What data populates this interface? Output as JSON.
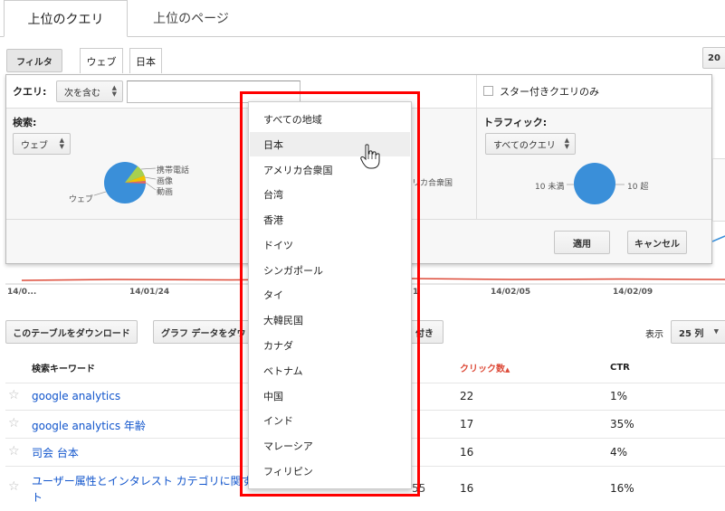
{
  "tabs": [
    {
      "label": "上位のクエリ",
      "active": true
    },
    {
      "label": "上位のページ",
      "active": false
    }
  ],
  "filter_bar": {
    "filter_label": "フィルタ",
    "chips": [
      "ウェブ",
      "日本"
    ],
    "right_stub": "20"
  },
  "query_row": {
    "label": "クエリ:",
    "condition": "次を含む",
    "input_value": "",
    "starred_only_label": "スター付きクエリのみ"
  },
  "search_section": {
    "label": "検索:",
    "select": "ウェブ",
    "pie_labels": [
      "携帯電話",
      "画像",
      "動画",
      "ウェブ"
    ],
    "location_pie_label_partial": "リカ合衆国"
  },
  "traffic_section": {
    "label": "トラフィック:",
    "select": "すべてのクエリ",
    "left_label": "10 未満",
    "right_label": "10 超"
  },
  "panel_buttons": {
    "apply": "適用",
    "cancel": "キャンセル"
  },
  "location_dropdown": {
    "highlighted_index": 1,
    "options": [
      "すべての地域",
      "日本",
      "アメリカ合衆国",
      "台湾",
      "香港",
      "ドイツ",
      "シンガポール",
      "タイ",
      "大韓民国",
      "カナダ",
      "ベトナム",
      "中国",
      "インド",
      "マレーシア",
      "フィリピン"
    ]
  },
  "chart_axis": {
    "ticks": [
      "14/0...",
      "14/01/24",
      "1",
      "14/02/05",
      "14/02/09"
    ]
  },
  "table_toolbar": {
    "download_table": "このテーブルをダウンロード",
    "download_chart_partial": "グラフ データをダウ",
    "third_button_partial": "付き",
    "show_label": "表示",
    "rows_select": "25 列"
  },
  "table": {
    "columns": {
      "keyword": "検索キーワード",
      "clicks": "クリック数",
      "ctr": "CTR"
    },
    "sort_indicator": "▲",
    "rows": [
      {
        "keyword": "google analytics",
        "clicks": "22",
        "ctr": "1%"
      },
      {
        "keyword": "google analytics 年齢",
        "clicks": "17",
        "ctr": "35%"
      },
      {
        "keyword": "司会 台本",
        "clicks": "16",
        "ctr": "4%"
      },
      {
        "keyword": "ユーザー属性とインタレスト カテゴリに関す",
        "keyword_wrap": "ト",
        "hidden_partial": "55",
        "clicks": "16",
        "ctr": "16%"
      }
    ]
  },
  "colors": {
    "link": "#1155cc",
    "sort_header": "#dd4b39",
    "pie_blue": "#3a8fd9",
    "pie_green": "#a8d04f",
    "pie_yellow": "#f2c200",
    "highlight_border": "#ff0000",
    "trend_red": "#dd4b39"
  }
}
